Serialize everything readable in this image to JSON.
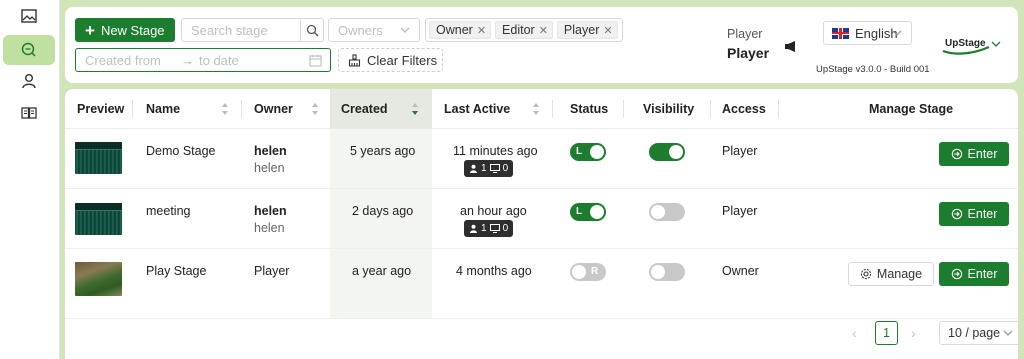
{
  "sidebar": {
    "items": [
      {
        "icon": "image-icon",
        "active": false
      },
      {
        "icon": "chat-icon",
        "active": true
      },
      {
        "icon": "user-icon",
        "active": false
      },
      {
        "icon": "book-icon",
        "active": false
      }
    ]
  },
  "header": {
    "new_stage_label": "New Stage",
    "search_placeholder": "Search stage",
    "owners_placeholder": "Owners",
    "role_tags": [
      "Owner",
      "Editor",
      "Player"
    ],
    "created_from_placeholder": "Created from",
    "to_date_placeholder": "to date",
    "clear_filters_label": "Clear Filters",
    "player_label": "Player",
    "player_name": "Player",
    "language": "English",
    "build_info": "UpStage v3.0.0 - Build 001",
    "logo_text": "UpStage"
  },
  "table": {
    "columns": [
      "Preview",
      "Name",
      "Owner",
      "Created",
      "Last Active",
      "Status",
      "Visibility",
      "Access",
      "Manage Stage"
    ],
    "rows": [
      {
        "name": "Demo Stage",
        "owner_name": "helen",
        "owner_username": "helen",
        "created": "5 years ago",
        "last_active": "11 minutes ago",
        "players": "1",
        "screens": "0",
        "status_on": true,
        "status_letter": "L",
        "visibility_on": true,
        "access": "Player",
        "show_manage": false,
        "enter_label": "Enter",
        "preview": "curtain"
      },
      {
        "name": "meeting",
        "owner_name": "helen",
        "owner_username": "helen",
        "created": "2 days ago",
        "last_active": "an hour ago",
        "players": "1",
        "screens": "0",
        "status_on": true,
        "status_letter": "L",
        "visibility_on": false,
        "access": "Player",
        "show_manage": false,
        "enter_label": "Enter",
        "preview": "curtain"
      },
      {
        "name": "Play Stage",
        "owner_name": "Player",
        "owner_username": "",
        "created": "a year ago",
        "last_active": "4 months ago",
        "players": "",
        "screens": "",
        "status_on": false,
        "status_letter": "R",
        "visibility_on": false,
        "access": "Owner",
        "show_manage": true,
        "manage_label": "Manage",
        "enter_label": "Enter",
        "preview": "play"
      }
    ]
  },
  "pagination": {
    "current_page": "1",
    "page_size": "10 / page"
  },
  "colors": {
    "accent": "#1c7d2e",
    "background": "#d2e4b9",
    "sidebar_active": "#bfe0a0",
    "toggle_off": "#c8c8c8"
  }
}
